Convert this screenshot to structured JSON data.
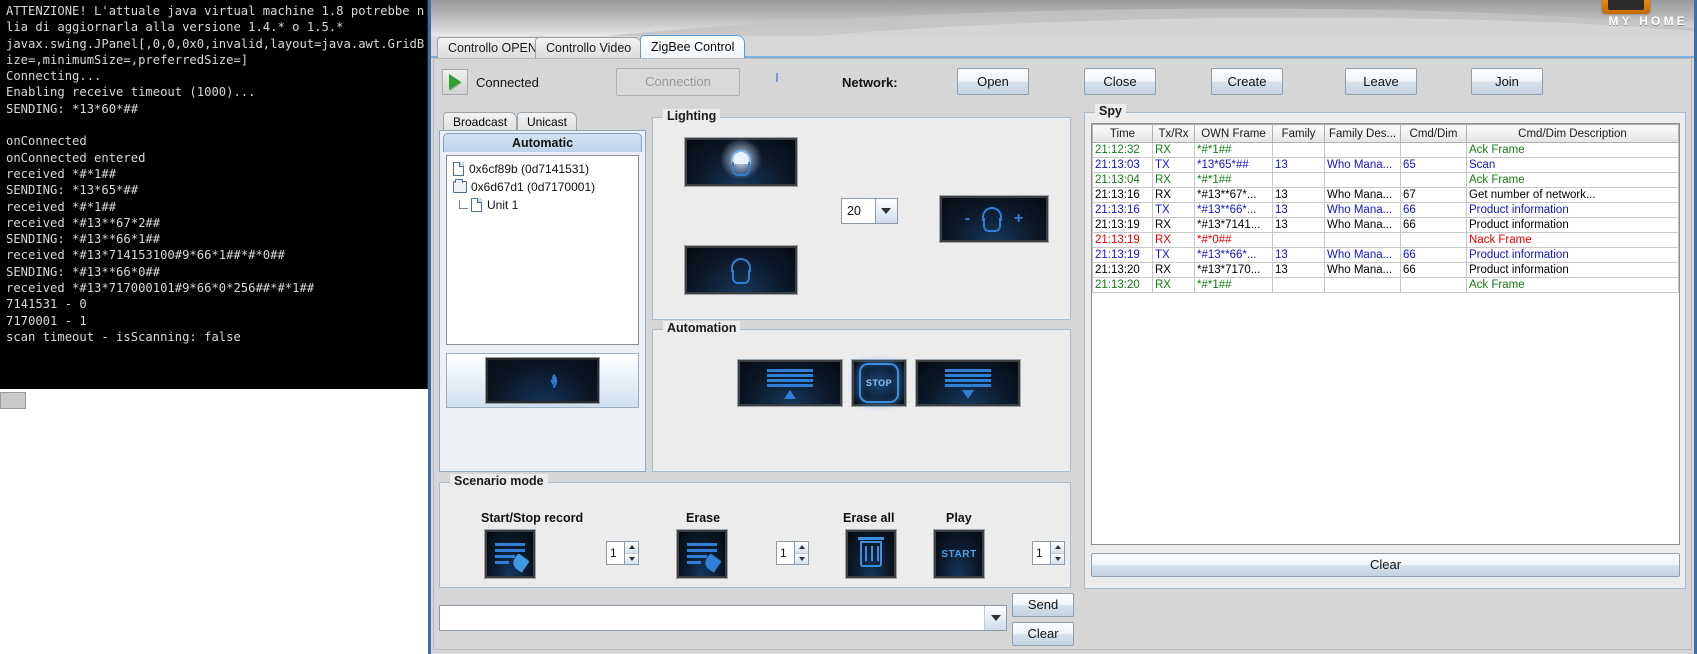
{
  "console": {
    "lines": [
      "ATTENZIONE! L'attuale java virtual machine 1.8 potrebbe n",
      "lia di aggiornarla alla versione 1.4.* o 1.5.*",
      "javax.swing.JPanel[,0,0,0x0,invalid,layout=java.awt.GridB",
      "ize=,minimumSize=,preferredSize=]",
      "Connecting...",
      "Enabling receive timeout (1000)...",
      "SENDING: *13*60*##",
      "",
      "onConnected",
      "onConnected entered",
      "received *#*1##",
      "SENDING: *13*65*##",
      "received *#*1##",
      "received *#13**67*2##",
      "SENDING: *#13**66*1##",
      "received *#13*714153100#9*66*1##*#*0##",
      "SENDING: *#13**66*0##",
      "received *#13*717000101#9*66*0*256##*#*1##",
      "7141531 - 0",
      "7170001 - 1",
      "scan timeout - isScanning: false"
    ]
  },
  "branding": {
    "logo_text": "MY HOME",
    "logo_icon": "home-badge-icon"
  },
  "tabs": [
    {
      "label": "Controllo OPEN",
      "active": false
    },
    {
      "label": "Controllo Video",
      "active": false
    },
    {
      "label": "ZigBee Control",
      "active": true
    }
  ],
  "toolbar": {
    "status_icon": "play-triangle-icon",
    "status_label": "Connected",
    "connection_button": "Connection",
    "network_label": "Network:",
    "buttons": [
      {
        "label": "Open"
      },
      {
        "label": "Close"
      },
      {
        "label": "Create"
      },
      {
        "label": "Leave"
      },
      {
        "label": "Join"
      }
    ]
  },
  "selector": {
    "tabs": [
      {
        "label": "Broadcast"
      },
      {
        "label": "Unicast"
      }
    ],
    "sub_tab": "Automatic",
    "tree": [
      {
        "icon": "file-icon",
        "label": "0x6cf89b (0d7141531)",
        "indent": 0
      },
      {
        "icon": "folder-icon",
        "label": "0x6d67d1 (0d7170001)",
        "indent": 0
      },
      {
        "icon": "file-icon",
        "label": "Unit 1",
        "indent": 1
      }
    ],
    "scan_button_icon": "signal-wave-icon"
  },
  "lighting": {
    "title": "Lighting",
    "on_button_icon": "lamp-on-icon",
    "off_button_icon": "lamp-off-icon",
    "level_value": "20",
    "dimmer_button_icon": "lamp-dimmer-icon",
    "dimmer_minus": "-",
    "dimmer_plus": "+"
  },
  "automation": {
    "title": "Automation",
    "up_icon": "shutter-up-icon",
    "stop_icon": "stop-icon",
    "stop_label": "STOP",
    "down_icon": "shutter-down-icon"
  },
  "scenario": {
    "title": "Scenario mode",
    "items": [
      {
        "label": "Start/Stop record",
        "icon": "record-scenario-icon",
        "spinner": "1"
      },
      {
        "label": "Erase",
        "icon": "erase-scenario-icon",
        "spinner": "1"
      },
      {
        "label": "Erase all",
        "icon": "trash-icon",
        "spinner": null
      },
      {
        "label": "Play",
        "icon": "start-icon",
        "spinner": "1",
        "icon_text": "START"
      }
    ]
  },
  "command_bar": {
    "input_value": "",
    "input_dropdown_icon": "chevron-down-icon",
    "send_label": "Send",
    "clear_label": "Clear"
  },
  "spy": {
    "title": "Spy",
    "clear_label": "Clear",
    "columns": [
      "Time",
      "Tx/Rx",
      "OWN Frame",
      "Family",
      "Family Des...",
      "Cmd/Dim",
      "Cmd/Dim Description"
    ],
    "rows": [
      {
        "color": "green",
        "cells": [
          "21:12:32",
          "RX",
          "*#*1##",
          "",
          "",
          "",
          "Ack Frame"
        ]
      },
      {
        "color": "blue",
        "cells": [
          "21:13:03",
          "TX",
          "*13*65*##",
          "13",
          "Who Mana...",
          "65",
          "Scan"
        ]
      },
      {
        "color": "green",
        "cells": [
          "21:13:04",
          "RX",
          "*#*1##",
          "",
          "",
          "",
          "Ack Frame"
        ]
      },
      {
        "color": "black",
        "cells": [
          "21:13:16",
          "RX",
          "*#13**67*...",
          "13",
          "Who Mana...",
          "67",
          "Get number of network..."
        ]
      },
      {
        "color": "blue",
        "cells": [
          "21:13:16",
          "TX",
          "*#13**66*...",
          "13",
          "Who Mana...",
          "66",
          "Product information"
        ]
      },
      {
        "color": "black",
        "cells": [
          "21:13:19",
          "RX",
          "*#13*7141...",
          "13",
          "Who Mana...",
          "66",
          "Product information"
        ]
      },
      {
        "color": "red",
        "cells": [
          "21:13:19",
          "RX",
          "*#*0##",
          "",
          "",
          "",
          "Nack Frame"
        ]
      },
      {
        "color": "blue",
        "cells": [
          "21:13:19",
          "TX",
          "*#13**66*...",
          "13",
          "Who Mana...",
          "66",
          "Product information"
        ]
      },
      {
        "color": "black",
        "cells": [
          "21:13:20",
          "RX",
          "*#13*7170...",
          "13",
          "Who Mana...",
          "66",
          "Product information"
        ]
      },
      {
        "color": "green",
        "cells": [
          "21:13:20",
          "RX",
          "*#*1##",
          "",
          "",
          "",
          "Ack Frame"
        ]
      }
    ]
  }
}
